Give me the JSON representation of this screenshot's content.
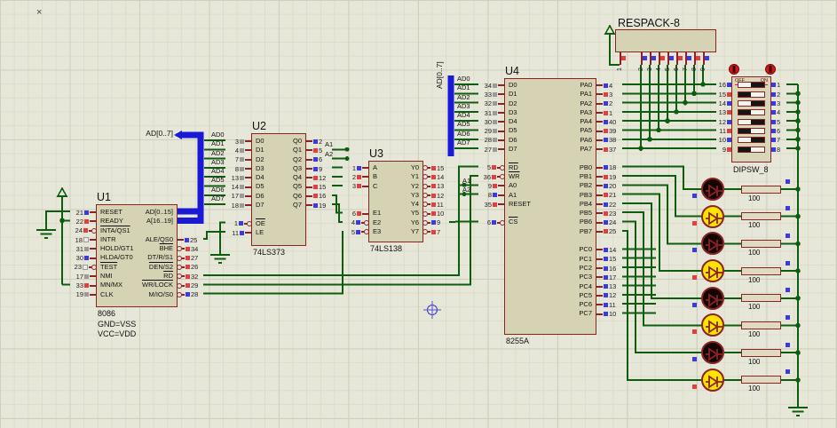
{
  "markers": {
    "corner": "×"
  },
  "colors": {
    "wire": "#0e5c0e",
    "bus": "#1a1ad6",
    "chip_fill": "#d6d3b5",
    "chip_border": "#8b2323",
    "led_on": "#ffe400",
    "led_off": "#140404",
    "state_high": "#e04040",
    "state_low": "#3a3ae0"
  },
  "labels": {
    "bus_left": "AD[0..7]",
    "bus_right": "AD[0..7]"
  },
  "nets": {
    "a1": "A1",
    "a2": "A2",
    "ad_lines": [
      "AD0",
      "AD1",
      "AD2",
      "AD3",
      "AD4",
      "AD5",
      "AD6",
      "AD7"
    ]
  },
  "u1": {
    "ref": "U1",
    "notes": [
      "8086",
      "GND=VSS",
      "VCC=VDD"
    ],
    "left": [
      {
        "n": "21",
        "l": "RESET",
        "sq": "b"
      },
      {
        "n": "22",
        "l": "READY",
        "sq": "r"
      },
      {
        "n": "24",
        "l": "INTA/QS1",
        "sq": "r",
        "ov": 1,
        "bub": 1
      },
      {
        "n": "18",
        "l": "INTR",
        "sq": "w"
      },
      {
        "n": "31",
        "l": "HOLD/GT1",
        "sq": "g"
      },
      {
        "n": "30",
        "l": "HLDA/GT0",
        "sq": "b"
      },
      {
        "n": "23",
        "l": "TEST",
        "sq": "w",
        "ov": 1,
        "bub": 1
      },
      {
        "n": "17",
        "l": "NMI",
        "sq": "g"
      },
      {
        "n": "33",
        "l": "MN/MX",
        "sq": "r"
      },
      {
        "n": "19",
        "l": "CLK",
        "sq": "g"
      }
    ],
    "right": [
      {
        "n": "",
        "l": "AD[0..15]",
        "sq": "n",
        "c": "nostub"
      },
      {
        "n": "",
        "l": "A[16..19]",
        "sq": "n",
        "c": "nostub"
      },
      {
        "c": "sp"
      },
      {
        "n": "25",
        "l": "ALE/QS0",
        "sq": "b"
      },
      {
        "n": "34",
        "l": "BHE",
        "sq": "r",
        "ov": 1,
        "bub": 1
      },
      {
        "n": "27",
        "l": "DT/R/S1",
        "sq": "r",
        "bub": 1
      },
      {
        "n": "26",
        "l": "DEN/S2",
        "sq": "r",
        "ov": 1,
        "bub": 1
      },
      {
        "n": "32",
        "l": "RD",
        "sq": "r",
        "ov": 1,
        "bub": 1
      },
      {
        "n": "29",
        "l": "WR/LOCK",
        "sq": "r",
        "ov": 1,
        "bub": 1
      },
      {
        "n": "28",
        "l": "M/IO/S0",
        "sq": "b",
        "bub": 1
      }
    ]
  },
  "u2": {
    "ref": "U2",
    "part": "74LS373",
    "left": [
      {
        "n": "3",
        "l": "D0",
        "sq": "g"
      },
      {
        "n": "4",
        "l": "D1",
        "sq": "g"
      },
      {
        "n": "7",
        "l": "D2",
        "sq": "g"
      },
      {
        "n": "8",
        "l": "D3",
        "sq": "g"
      },
      {
        "n": "13",
        "l": "D4",
        "sq": "g"
      },
      {
        "n": "14",
        "l": "D5",
        "sq": "g"
      },
      {
        "n": "17",
        "l": "D6",
        "sq": "g"
      },
      {
        "n": "18",
        "l": "D7",
        "sq": "g"
      },
      {
        "c": "sp"
      },
      {
        "n": "1",
        "l": "OE",
        "sq": "b",
        "ov": 1,
        "bub": 1
      },
      {
        "n": "11",
        "l": "LE",
        "sq": "b"
      }
    ],
    "right": [
      {
        "n": "2",
        "l": "Q0",
        "sq": "b"
      },
      {
        "n": "5",
        "l": "Q1",
        "sq": "r"
      },
      {
        "n": "6",
        "l": "Q2",
        "sq": "b"
      },
      {
        "n": "9",
        "l": "Q3",
        "sq": "b"
      },
      {
        "n": "12",
        "l": "Q4",
        "sq": "r"
      },
      {
        "n": "15",
        "l": "Q5",
        "sq": "r"
      },
      {
        "n": "16",
        "l": "Q6",
        "sq": "r"
      },
      {
        "n": "19",
        "l": "Q7",
        "sq": "b"
      }
    ]
  },
  "u3": {
    "ref": "U3",
    "part": "74LS138",
    "left": [
      {
        "n": "1",
        "l": "A",
        "sq": "b"
      },
      {
        "n": "2",
        "l": "B",
        "sq": "r"
      },
      {
        "n": "3",
        "l": "C",
        "sq": "r"
      },
      {
        "c": "sp"
      },
      {
        "c": "sp"
      },
      {
        "n": "6",
        "l": "E1",
        "sq": "r"
      },
      {
        "n": "4",
        "l": "E2",
        "sq": "b",
        "bub": 1
      },
      {
        "n": "5",
        "l": "E3",
        "sq": "b",
        "bub": 1
      }
    ],
    "right": [
      {
        "n": "15",
        "l": "Y0",
        "sq": "r",
        "bub": 1
      },
      {
        "n": "14",
        "l": "Y1",
        "sq": "r",
        "bub": 1
      },
      {
        "n": "13",
        "l": "Y2",
        "sq": "r",
        "bub": 1
      },
      {
        "n": "12",
        "l": "Y3",
        "sq": "r",
        "bub": 1
      },
      {
        "n": "11",
        "l": "Y4",
        "sq": "r",
        "bub": 1
      },
      {
        "n": "10",
        "l": "Y5",
        "sq": "r",
        "bub": 1
      },
      {
        "n": "9",
        "l": "Y6",
        "sq": "b",
        "bub": 1
      },
      {
        "n": "7",
        "l": "Y7",
        "sq": "r",
        "bub": 1
      }
    ]
  },
  "u4": {
    "ref": "U4",
    "part": "8255A",
    "left": [
      {
        "n": "34",
        "l": "D0",
        "sq": "g"
      },
      {
        "n": "33",
        "l": "D1",
        "sq": "g"
      },
      {
        "n": "32",
        "l": "D2",
        "sq": "g"
      },
      {
        "n": "31",
        "l": "D3",
        "sq": "g"
      },
      {
        "n": "30",
        "l": "D4",
        "sq": "g"
      },
      {
        "n": "29",
        "l": "D5",
        "sq": "g"
      },
      {
        "n": "28",
        "l": "D6",
        "sq": "g"
      },
      {
        "n": "27",
        "l": "D7",
        "sq": "g"
      },
      {
        "c": "sp"
      },
      {
        "n": "5",
        "l": "RD",
        "sq": "r",
        "ov": 1,
        "bub": 1
      },
      {
        "n": "36",
        "l": "WR",
        "sq": "r",
        "ov": 1,
        "bub": 1
      },
      {
        "n": "9",
        "l": "A0",
        "sq": "r"
      },
      {
        "n": "8",
        "l": "A1",
        "sq": "b"
      },
      {
        "n": "35",
        "l": "RESET",
        "sq": "r"
      },
      {
        "c": "sp"
      },
      {
        "n": "6",
        "l": "CS",
        "sq": "b",
        "ov": 1,
        "bub": 1
      }
    ],
    "right": [
      {
        "n": "4",
        "l": "PA0",
        "sq": "b"
      },
      {
        "n": "3",
        "l": "PA1",
        "sq": "r"
      },
      {
        "n": "2",
        "l": "PA2",
        "sq": "b"
      },
      {
        "n": "1",
        "l": "PA3",
        "sq": "r"
      },
      {
        "n": "40",
        "l": "PA4",
        "sq": "b"
      },
      {
        "n": "39",
        "l": "PA5",
        "sq": "r"
      },
      {
        "n": "38",
        "l": "PA6",
        "sq": "b"
      },
      {
        "n": "37",
        "l": "PA7",
        "sq": "r"
      },
      {
        "c": "sp"
      },
      {
        "n": "18",
        "l": "PB0",
        "sq": "b"
      },
      {
        "n": "19",
        "l": "PB1",
        "sq": "r"
      },
      {
        "n": "20",
        "l": "PB2",
        "sq": "b"
      },
      {
        "n": "21",
        "l": "PB3",
        "sq": "r"
      },
      {
        "n": "22",
        "l": "PB4",
        "sq": "b"
      },
      {
        "n": "23",
        "l": "PB5",
        "sq": "r"
      },
      {
        "n": "24",
        "l": "PB6",
        "sq": "b"
      },
      {
        "n": "25",
        "l": "PB7",
        "sq": "r"
      },
      {
        "c": "sp"
      },
      {
        "n": "14",
        "l": "PC0",
        "sq": "b"
      },
      {
        "n": "15",
        "l": "PC1",
        "sq": "b"
      },
      {
        "n": "16",
        "l": "PC2",
        "sq": "b"
      },
      {
        "n": "17",
        "l": "PC3",
        "sq": "b"
      },
      {
        "n": "13",
        "l": "PC4",
        "sq": "b"
      },
      {
        "n": "12",
        "l": "PC5",
        "sq": "b"
      },
      {
        "n": "11",
        "l": "PC6",
        "sq": "b"
      },
      {
        "n": "10",
        "l": "PC7",
        "sq": "b"
      }
    ]
  },
  "respack": {
    "ref": "RESPACK-8",
    "pins": [
      {
        "n": "1",
        "sq": "r"
      },
      {
        "n": "2",
        "sq": "b"
      },
      {
        "n": "3",
        "sq": "b"
      },
      {
        "n": "4",
        "sq": "r"
      },
      {
        "n": "5",
        "sq": "b"
      },
      {
        "n": "6",
        "sq": "r"
      },
      {
        "n": "7",
        "sq": "b"
      },
      {
        "n": "8",
        "sq": "r"
      },
      {
        "n": "9",
        "sq": "b"
      }
    ]
  },
  "dipsw": {
    "ref": "DIPSW_8",
    "off_label": "OFF",
    "on_label": "ON",
    "left": [
      {
        "n": "16",
        "sq": "b"
      },
      {
        "n": "15",
        "sq": "r"
      },
      {
        "n": "14",
        "sq": "b"
      },
      {
        "n": "13",
        "sq": "r"
      },
      {
        "n": "12",
        "sq": "b"
      },
      {
        "n": "11",
        "sq": "r"
      },
      {
        "n": "10",
        "sq": "b"
      },
      {
        "n": "9",
        "sq": "r"
      }
    ],
    "right": [
      {
        "n": "1",
        "sq": "b"
      },
      {
        "n": "2",
        "sq": "b"
      },
      {
        "n": "3",
        "sq": "b"
      },
      {
        "n": "4",
        "sq": "b"
      },
      {
        "n": "5",
        "sq": "b"
      },
      {
        "n": "6",
        "sq": "b"
      },
      {
        "n": "7",
        "sq": "b"
      },
      {
        "n": "8",
        "sq": "b"
      }
    ],
    "switches": [
      {
        "state": "on"
      },
      {
        "state": "off"
      },
      {
        "state": "on"
      },
      {
        "state": "off"
      },
      {
        "state": "on"
      },
      {
        "state": "off"
      },
      {
        "state": "on"
      },
      {
        "state": "off"
      }
    ]
  },
  "leds": [
    {
      "state": "off",
      "sq": "b"
    },
    {
      "state": "on",
      "sq": "r"
    },
    {
      "state": "off",
      "sq": "b"
    },
    {
      "state": "on",
      "sq": "r"
    },
    {
      "state": "off",
      "sq": "b"
    },
    {
      "state": "on",
      "sq": "r"
    },
    {
      "state": "off",
      "sq": "b"
    },
    {
      "state": "on",
      "sq": "r"
    }
  ],
  "resistors": [
    {
      "v": "100",
      "sq": "b"
    },
    {
      "v": "100",
      "sq": "b"
    },
    {
      "v": "100",
      "sq": "b"
    },
    {
      "v": "100",
      "sq": "b"
    },
    {
      "v": "100",
      "sq": "b"
    },
    {
      "v": "100",
      "sq": "b"
    },
    {
      "v": "100",
      "sq": "b"
    },
    {
      "v": "100",
      "sq": "b"
    }
  ]
}
